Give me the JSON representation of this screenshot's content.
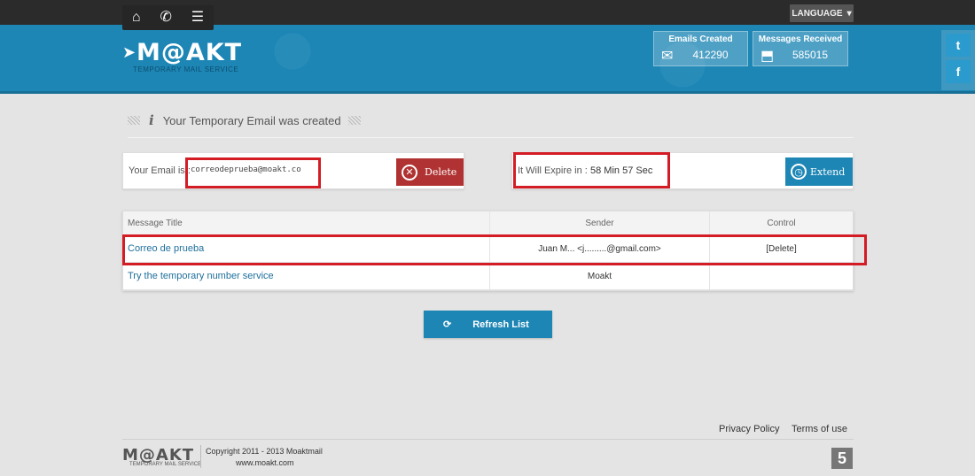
{
  "nav": {
    "home_icon": "⌂",
    "phone_icon": "✆",
    "menu_icon": "☰",
    "language": "LANGUAGE"
  },
  "logo": {
    "title": "M@AKT",
    "subtitle": "TEMPORARY MAIL SERVICE"
  },
  "stats": {
    "emails_created_label": "Emails Created",
    "emails_created_value": "412290",
    "messages_received_label": "Messages Received",
    "messages_received_value": "585015"
  },
  "social": {
    "twitter": "t",
    "facebook": "f"
  },
  "notice": {
    "icon": "i",
    "text": "Your Temporary Email was created"
  },
  "email": {
    "label": "Your Email is :",
    "address": "correodeprueba@moakt.co",
    "delete_label": "Delete"
  },
  "expire": {
    "label": "It Will Expire in :",
    "value": "58 Min 57 Sec",
    "extend_label": "Extend"
  },
  "table": {
    "headers": [
      "Message Title",
      "Sender",
      "Control"
    ],
    "rows": [
      {
        "title": "Correo de prueba",
        "sender": "Juan M...  <j.........@gmail.com>",
        "control": "[Delete]"
      },
      {
        "title": "Try the temporary number service",
        "sender": "Moakt",
        "control": ""
      }
    ]
  },
  "refresh_label": "Refresh List",
  "footer": {
    "privacy": "Privacy Policy",
    "terms": "Terms of use",
    "logo": "M@AKT",
    "logo_sub": "TEMPORARY MAIL SERVICE",
    "copyright": "Copyright 2011 - 2013 Moaktmail",
    "site": "www.moakt.com",
    "badge": "5"
  }
}
